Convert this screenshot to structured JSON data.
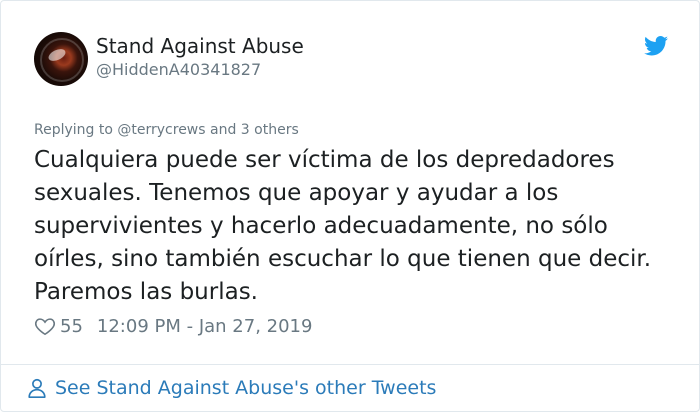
{
  "tweet": {
    "author": {
      "display_name": "Stand Against Abuse",
      "handle": "@HiddenA40341827"
    },
    "reply_context": {
      "prefix": "Replying to",
      "mention": "@terrycrews",
      "suffix": "and 3 others"
    },
    "text": "Cualquiera puede ser víctima de los depredadores sexuales. Tenemos que apoyar y ayudar a los supervivientes y hacerlo adecuadamente, no sólo oírles, sino también escuchar lo que tienen que decir. Paremos las burlas.",
    "likes": "55",
    "timestamp": "12:09 PM - Jan 27, 2019"
  },
  "footer": {
    "link_label": "See Stand Against Abuse's other Tweets"
  },
  "icons": {
    "brand": "twitter-bird-icon",
    "like": "heart-icon",
    "profile": "person-icon"
  },
  "colors": {
    "brand_blue": "#1da1f2",
    "link_blue": "#2b7bb9",
    "secondary_text": "#697882",
    "primary_text": "#1c2022",
    "border": "#e1e8ed"
  }
}
